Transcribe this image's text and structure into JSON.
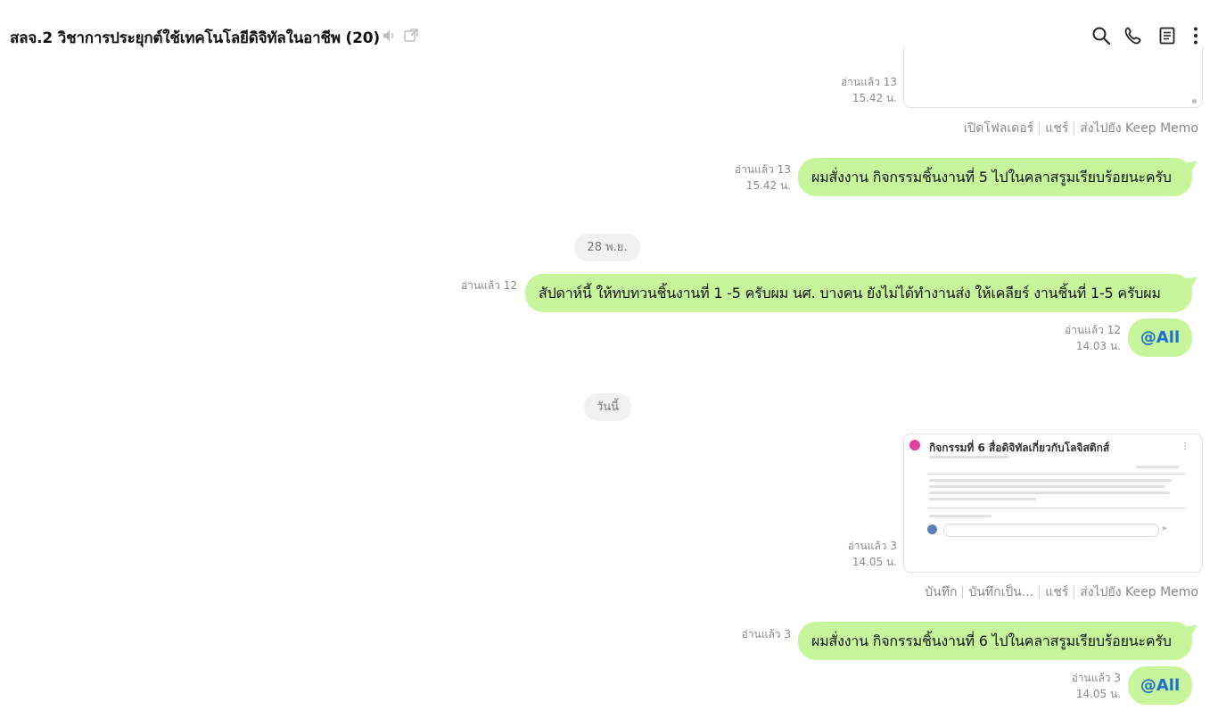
{
  "header": {
    "title": "สลจ.2 วิชาการประยุกต์ใช้เทคโนโลยีดิจิทัลในอาชีพ (20)",
    "icons": [
      "mute-icon",
      "external-window-icon",
      "search-icon",
      "phone-icon",
      "notes-icon",
      "more-icon"
    ]
  },
  "colors": {
    "bubble": "#c6f59c",
    "mention": "#1e6fd0",
    "meta": "#8a8a8a",
    "date_pill": "#f1f1f1"
  },
  "messages": {
    "card_top": {
      "read": "อ่านแล้ว 13",
      "time": "15.42 น.",
      "actions": [
        "เปิดโฟลเดอร์",
        "แชร์",
        "ส่งไปยัง Keep Memo"
      ]
    },
    "msg1": {
      "read": "อ่านแล้ว 13",
      "time": "15.42 น.",
      "text": "ผมสั่งงาน กิจกรรมชิ้นงานที่ 5 ไปในคลาสรูมเรียบร้อยนะครับ"
    },
    "date1": "28 พ.ย.",
    "msg2": {
      "read": "อ่านแล้ว 12",
      "text": "สัปดาห์นี้ ให้ทบทวนชิ้นงานที่ 1 -5 ครับผม นศ. บางคน ยังไม่ได้ทำงานส่ง ให้เคลียร์ งานชิ้นที่ 1-5 ครับผม"
    },
    "msg3": {
      "read": "อ่านแล้ว 12",
      "time": "14.03 น.",
      "text": "@All"
    },
    "date2": "วันนี้",
    "image_msg": {
      "read": "อ่านแล้ว 3",
      "time": "14.05 น.",
      "thumb_title": "กิจกรรมที่ 6 สื่อดิจิทัลเกี่ยวกับโลจิสติกส์",
      "actions": [
        "บันทึก",
        "บันทึกเป็น...",
        "แชร์",
        "ส่งไปยัง Keep Memo"
      ]
    },
    "msg4": {
      "read": "อ่านแล้ว 3",
      "text": "ผมสั่งงาน กิจกรรมชิ้นงานที่ 6 ไปในคลาสรูมเรียบร้อยนะครับ"
    },
    "msg5": {
      "read": "อ่านแล้ว 3",
      "time": "14.05 น.",
      "text": "@All"
    }
  }
}
